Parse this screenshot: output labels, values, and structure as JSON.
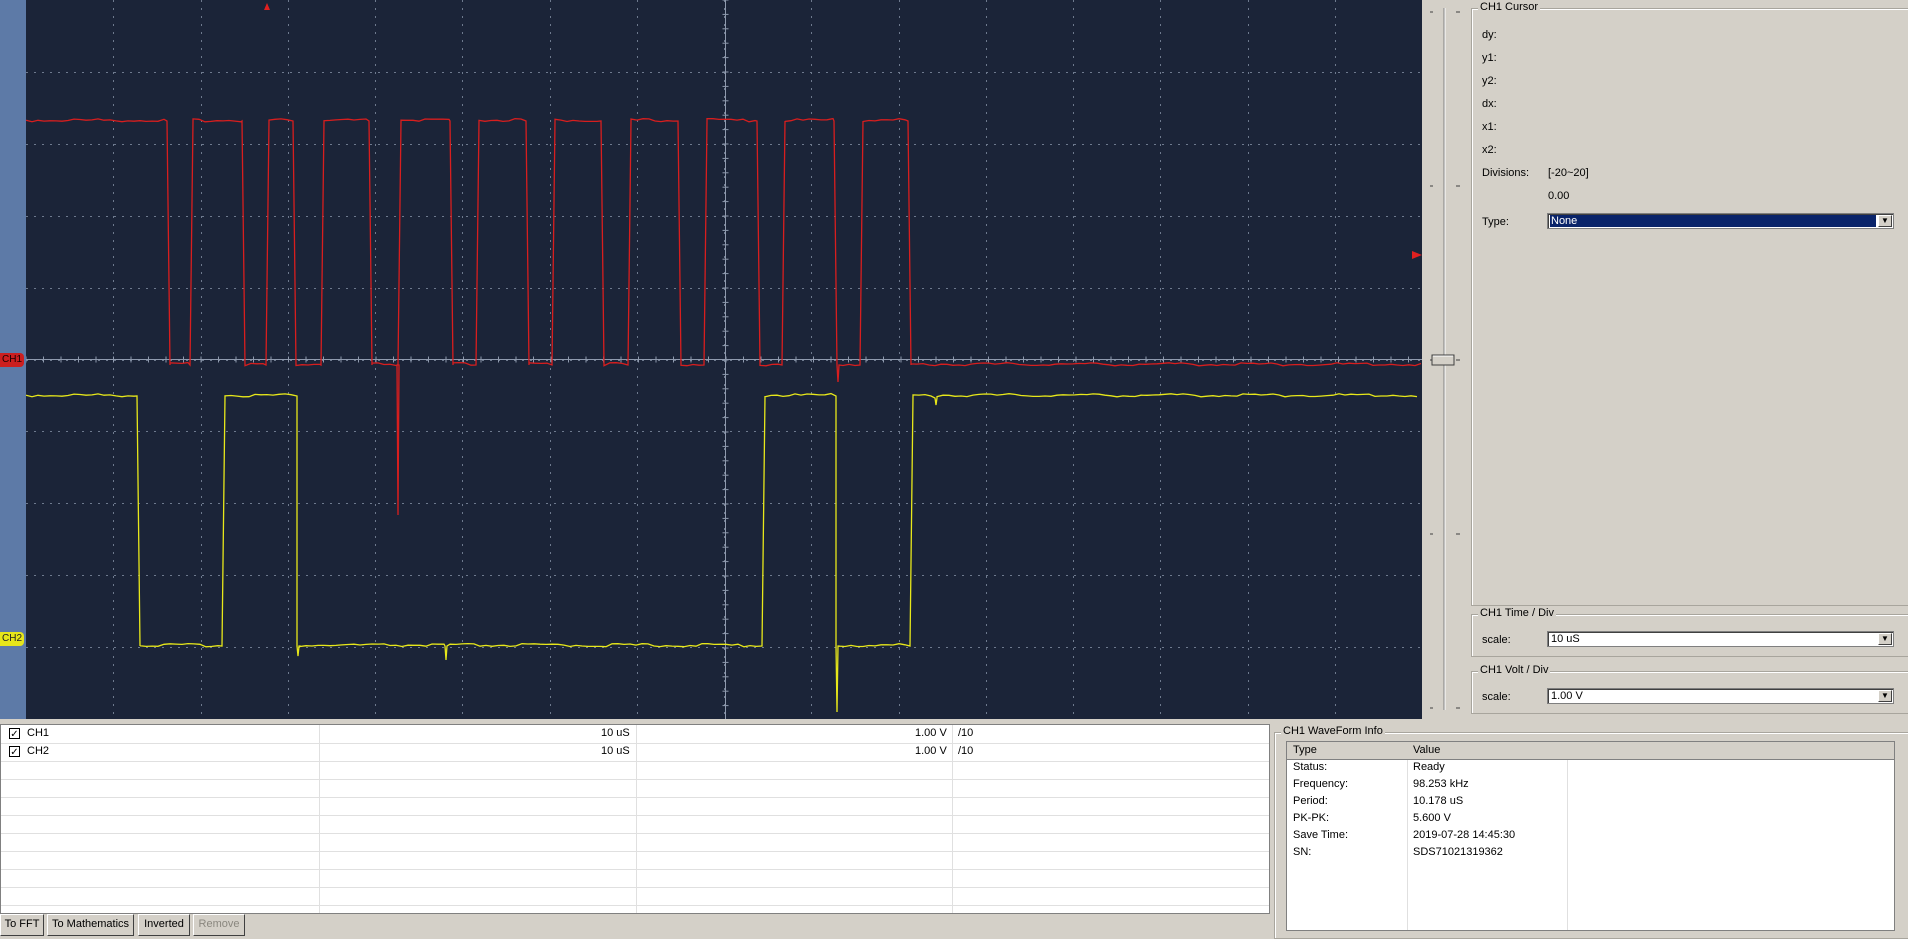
{
  "scope": {
    "ch1_marker": "CH1",
    "ch2_marker": "CH2",
    "trace_colors": {
      "ch1": "#d81e1e",
      "ch2": "#e8e81a",
      "grid": "#6e7a8e",
      "background": "#1b2438"
    }
  },
  "cursor_panel": {
    "title": "CH1 Cursor",
    "fields": [
      {
        "label": "dy:",
        "value": ""
      },
      {
        "label": "y1:",
        "value": ""
      },
      {
        "label": "y2:",
        "value": ""
      },
      {
        "label": "dx:",
        "value": ""
      },
      {
        "label": "x1:",
        "value": ""
      },
      {
        "label": "x2:",
        "value": ""
      }
    ],
    "divisions_label": "Divisions:",
    "divisions_range": "[-20~20]",
    "divisions_value": "0.00",
    "type_label": "Type:",
    "type_value": "None"
  },
  "time_div": {
    "title": "CH1 Time / Div",
    "scale_label": "scale:",
    "scale_value": "10 uS"
  },
  "volt_div": {
    "title": "CH1 Volt / Div",
    "scale_label": "scale:",
    "scale_value": "1.00 V"
  },
  "channels": [
    {
      "checked": true,
      "name": "CH1",
      "time": "10 uS",
      "volt": "1.00 V",
      "probe": "/10"
    },
    {
      "checked": true,
      "name": "CH2",
      "time": "10 uS",
      "volt": "1.00 V",
      "probe": "/10"
    }
  ],
  "buttons": {
    "to_fft": "To FFT",
    "to_math": "To Mathematics",
    "inverted": "Inverted",
    "remove": "Remove"
  },
  "waveform_info": {
    "title": "CH1 WaveForm Info",
    "header_type": "Type",
    "header_value": "Value",
    "rows": [
      {
        "type": "Status:",
        "value": "Ready"
      },
      {
        "type": "Frequency:",
        "value": "98.253 kHz"
      },
      {
        "type": "Period:",
        "value": "10.178 uS"
      },
      {
        "type": "PK-PK:",
        "value": "5.600 V"
      },
      {
        "type": "Save Time:",
        "value": "2019-07-28 14:45:30"
      },
      {
        "type": "SN:",
        "value": "SDS71021319362"
      }
    ]
  }
}
